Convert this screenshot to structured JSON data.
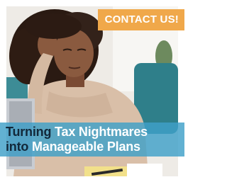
{
  "ad": {
    "cta_label": "CONTACT US!",
    "headline": {
      "line1_dark": "Turning ",
      "line1_light": "Tax Nightmares",
      "line2_dark": "into ",
      "line2_light": "Manageable Plans"
    },
    "colors": {
      "cta_background": "#f0a84a",
      "headline_band": "#3fa0c8",
      "headline_dark_text": "#12283a",
      "headline_light_text": "#ffffff"
    },
    "image_subject": "stressed woman at laptop holding her head"
  }
}
